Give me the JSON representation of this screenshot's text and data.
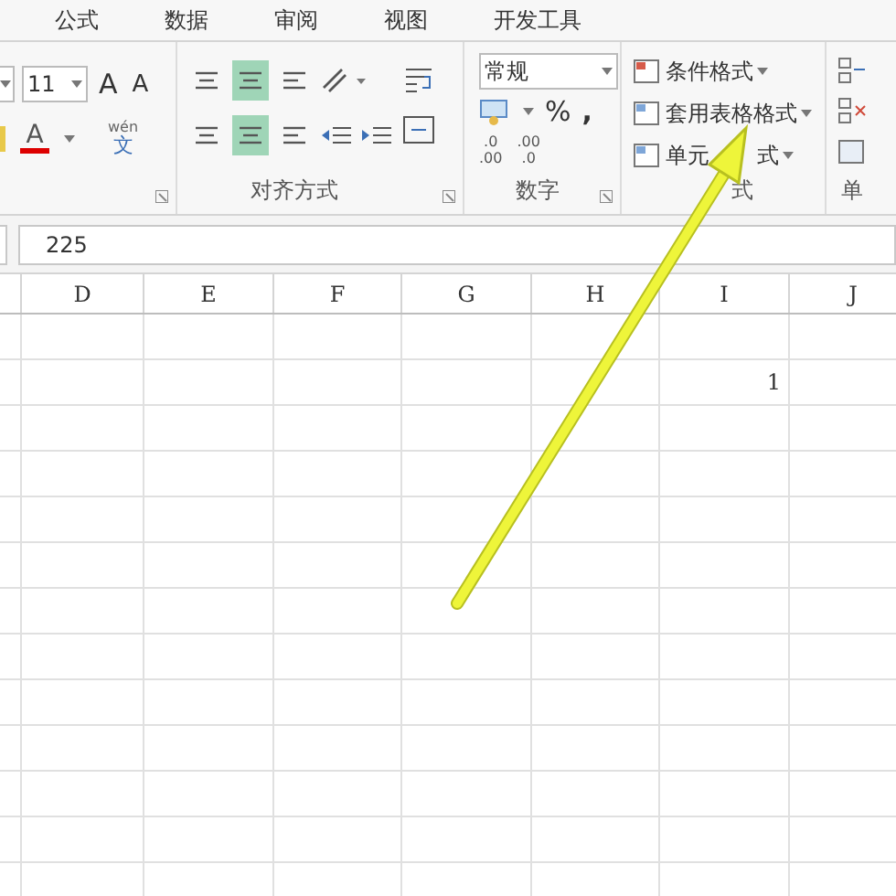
{
  "tabs": [
    {
      "label": "公式"
    },
    {
      "label": "数据"
    },
    {
      "label": "审阅"
    },
    {
      "label": "视图"
    },
    {
      "label": "开发工具"
    }
  ],
  "font_group": {
    "size": "11",
    "grow": "A",
    "shrink": "A",
    "color_letter": "A",
    "phonetic_top": "wén",
    "phonetic_bottom": "文"
  },
  "alignment_group": {
    "label": "对齐方式",
    "vertical": [
      {
        "selected": false
      },
      {
        "selected": true
      },
      {
        "selected": false
      }
    ],
    "horizontal": [
      {
        "selected": false
      },
      {
        "selected": true
      },
      {
        "selected": false
      }
    ]
  },
  "number_group": {
    "label": "数字",
    "format": "常规",
    "percent": "%",
    "comma": ",",
    "increase_decimal": [
      ".0",
      ".00"
    ],
    "decrease_decimal": [
      ".00",
      ".0"
    ]
  },
  "styles_group": {
    "label": [
      "式"
    ],
    "buttons": [
      [
        "条件格式"
      ],
      [
        "套用表格格式"
      ],
      [
        "单元",
        "式"
      ]
    ]
  },
  "cells_group": {
    "label": "单"
  },
  "formula_bar": {
    "value": "225"
  },
  "sheet": {
    "columns": [
      "D",
      "E",
      "F",
      "G",
      "H",
      "I",
      "J"
    ],
    "rows": [
      [
        {},
        {},
        {},
        {},
        {},
        {},
        {}
      ],
      [
        {},
        {},
        {},
        {},
        {},
        {
          "value": "1"
        },
        {}
      ],
      [
        {},
        {},
        {},
        {},
        {},
        {},
        {}
      ],
      [
        {},
        {},
        {},
        {},
        {},
        {},
        {}
      ],
      [
        {},
        {},
        {},
        {},
        {},
        {},
        {}
      ],
      [
        {},
        {},
        {},
        {},
        {},
        {},
        {}
      ],
      [
        {},
        {},
        {},
        {},
        {},
        {},
        {}
      ],
      [
        {},
        {},
        {},
        {},
        {},
        {},
        {}
      ],
      [
        {},
        {},
        {},
        {},
        {},
        {},
        {}
      ],
      [
        {},
        {},
        {},
        {},
        {},
        {},
        {}
      ],
      [
        {},
        {},
        {},
        {},
        {},
        {},
        {}
      ],
      [
        {},
        {},
        {},
        {},
        {},
        {},
        {}
      ],
      [
        {},
        {},
        {},
        {},
        {},
        {},
        {}
      ]
    ]
  }
}
